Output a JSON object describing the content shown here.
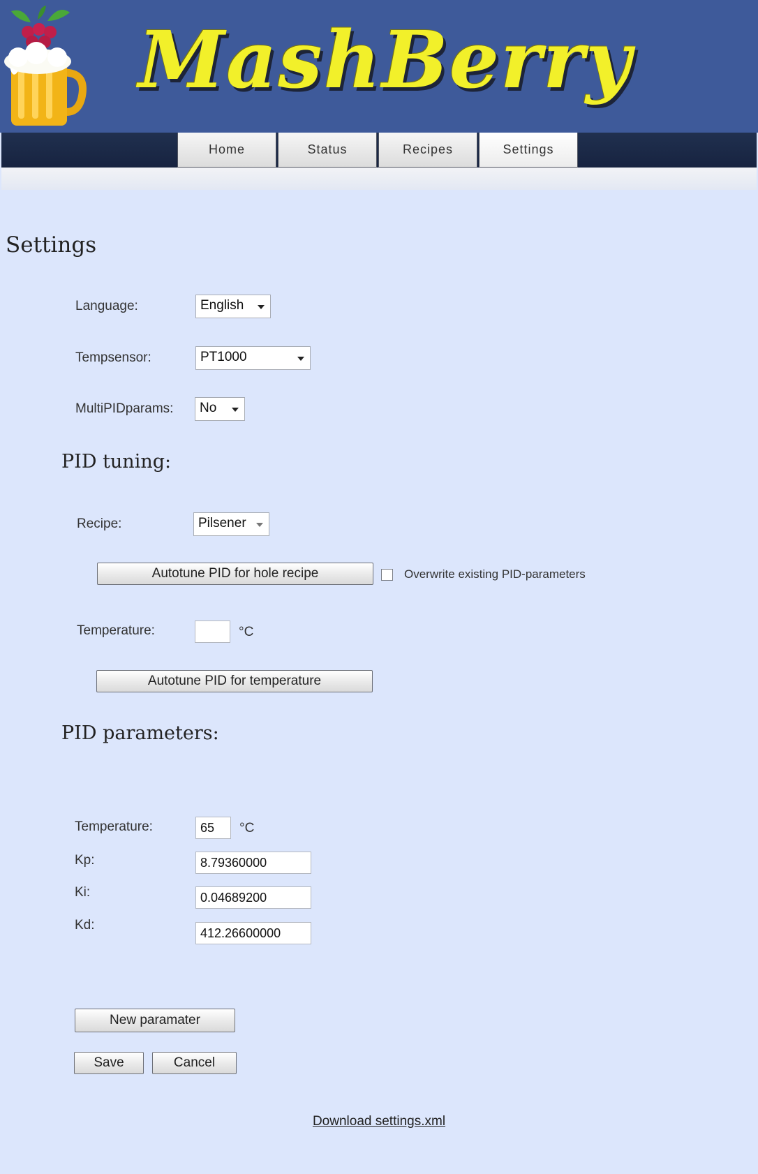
{
  "header": {
    "brand": "MashBerry"
  },
  "nav": {
    "tabs": [
      "Home",
      "Status",
      "Recipes",
      "Settings"
    ],
    "active": "Settings"
  },
  "page": {
    "title": "Settings"
  },
  "general": {
    "language_label": "Language:",
    "language_value": "English",
    "tempsensor_label": "Tempsensor:",
    "tempsensor_value": "PT1000",
    "multipid_label": "MultiPIDparams:",
    "multipid_value": "No"
  },
  "pid_tuning": {
    "title": "PID tuning:",
    "recipe_label": "Recipe:",
    "recipe_value": "Pilsener",
    "autotune_recipe_label": "Autotune PID for hole recipe",
    "overwrite_label": "Overwrite existing PID-parameters",
    "overwrite_checked": false,
    "temperature_label": "Temperature:",
    "temperature_value": "",
    "temperature_unit": "°C",
    "autotune_temp_label": "Autotune PID for temperature"
  },
  "pid_params": {
    "title": "PID parameters:",
    "temperature_label": "Temperature:",
    "temperature_value": "65",
    "temperature_unit": "°C",
    "kp_label": "Kp:",
    "kp_value": "8.79360000",
    "ki_label": "Ki:",
    "ki_value": "0.04689200",
    "kd_label": "Kd:",
    "kd_value": "412.26600000"
  },
  "actions": {
    "new_param_label": "New paramater",
    "save_label": "Save",
    "cancel_label": "Cancel",
    "download_label": "Download settings.xml"
  },
  "colors": {
    "header_bg": "#3e5a9a",
    "navbar_bg": "#1d2a47",
    "page_bg": "#dce6fc",
    "brand_yellow": "#f2f02a"
  },
  "icons": [
    "raspberry-beer-mug-logo",
    "dropdown-caret-icon"
  ]
}
